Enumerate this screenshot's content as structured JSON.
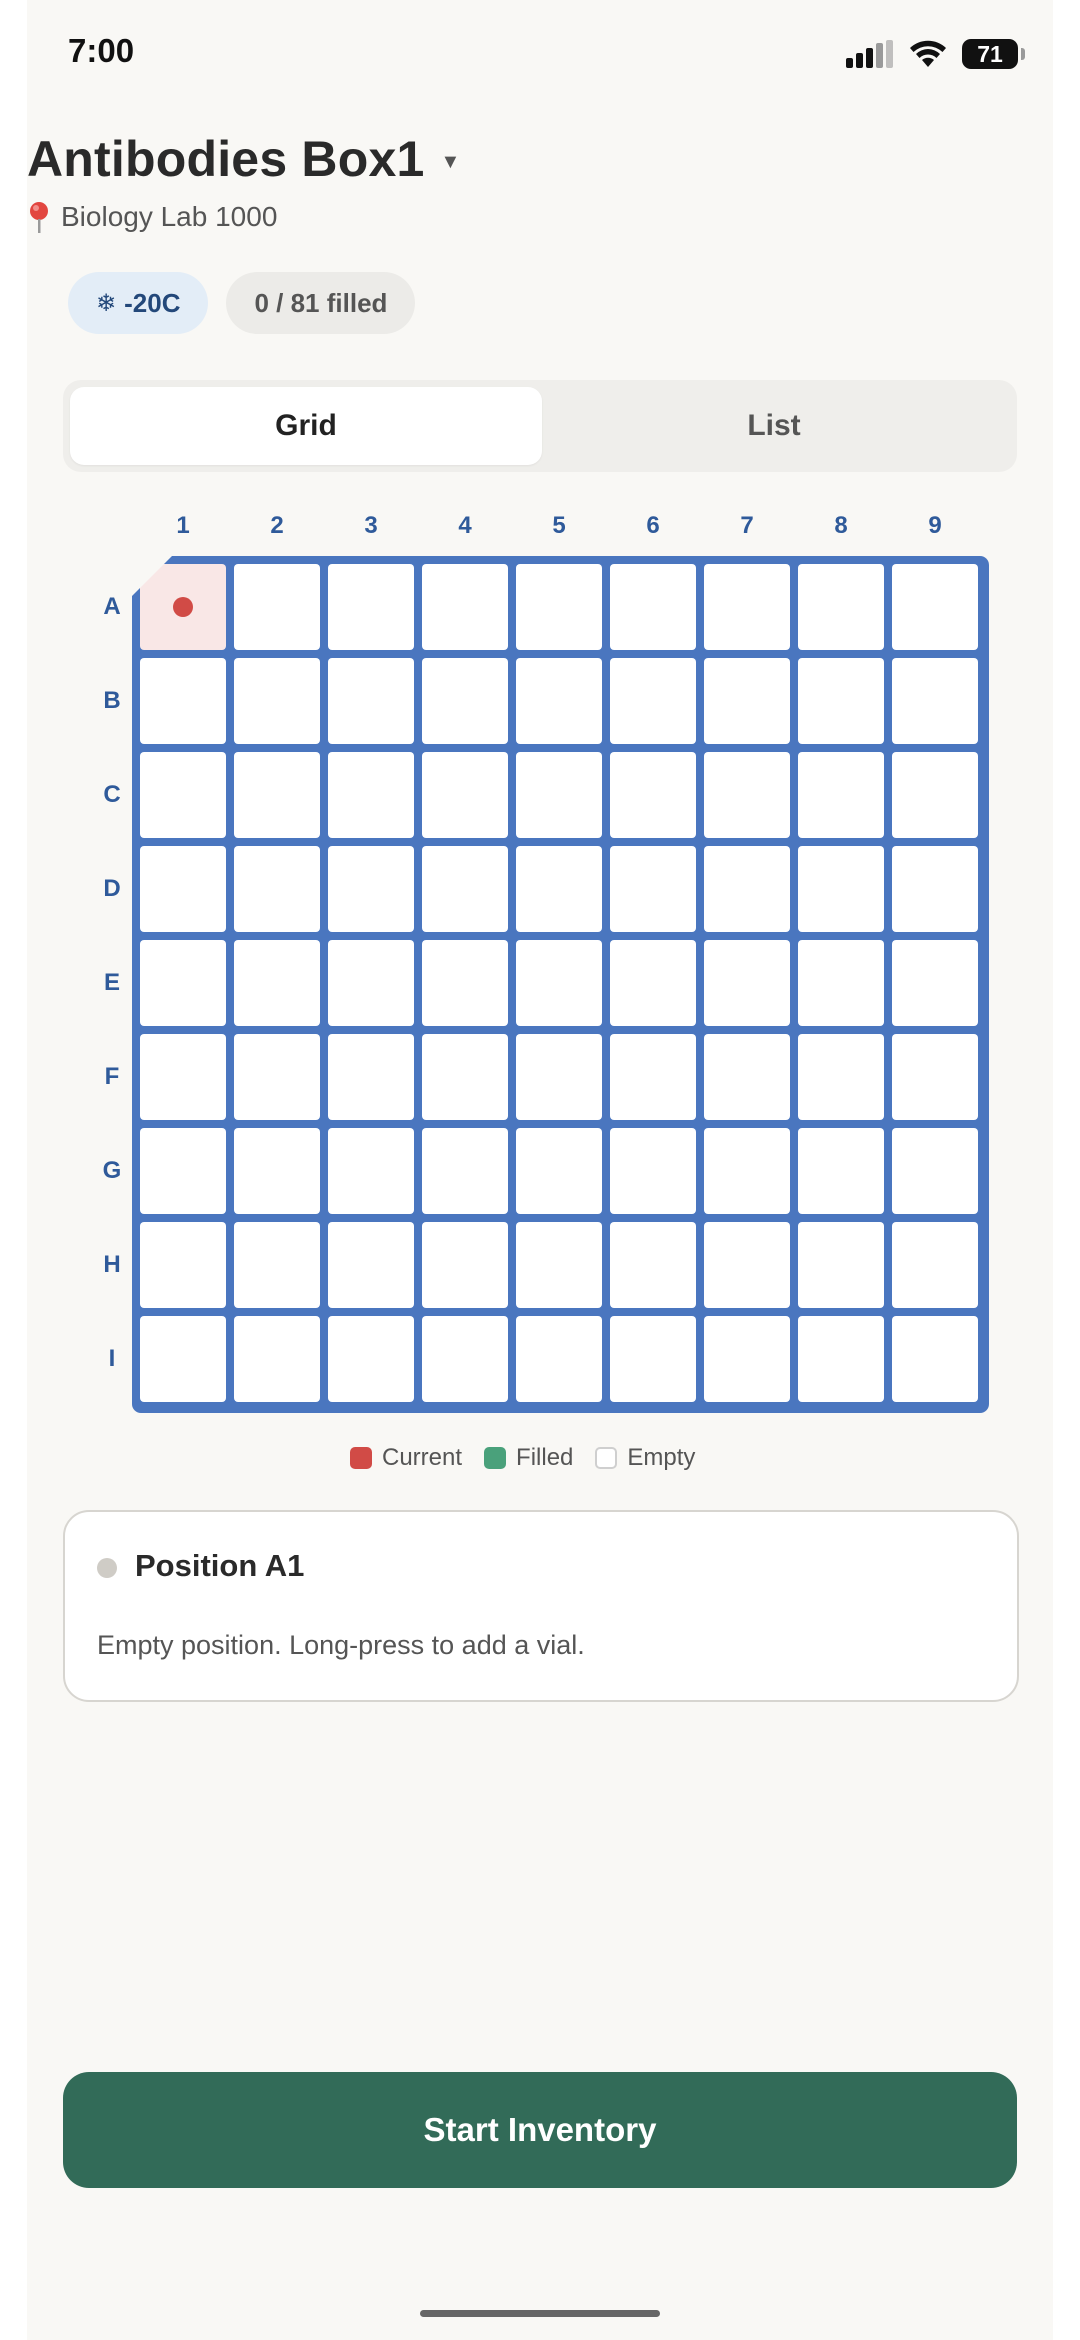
{
  "status_bar": {
    "time": "7:00",
    "battery": "71"
  },
  "header": {
    "title": "Antibodies Box1",
    "location": "Biology Lab 1000"
  },
  "chips": {
    "temperature": "-20C",
    "fill_status": "0 / 81 filled"
  },
  "view_toggle": {
    "grid_label": "Grid",
    "list_label": "List",
    "selected": "Grid"
  },
  "grid": {
    "columns": [
      "1",
      "2",
      "3",
      "4",
      "5",
      "6",
      "7",
      "8",
      "9"
    ],
    "rows": [
      "A",
      "B",
      "C",
      "D",
      "E",
      "F",
      "G",
      "H",
      "I"
    ],
    "current_position": "A1",
    "filled_positions": []
  },
  "legend": {
    "current": "Current",
    "filled": "Filled",
    "empty": "Empty"
  },
  "position_card": {
    "title": "Position A1",
    "description": "Empty position. Long-press to add a vial."
  },
  "actions": {
    "start_label": "Start Inventory"
  },
  "colors": {
    "accent_green": "#326b58",
    "grid_blue": "#4a76bf",
    "current_red": "#d14b46",
    "filled_green": "#4aa17b"
  }
}
